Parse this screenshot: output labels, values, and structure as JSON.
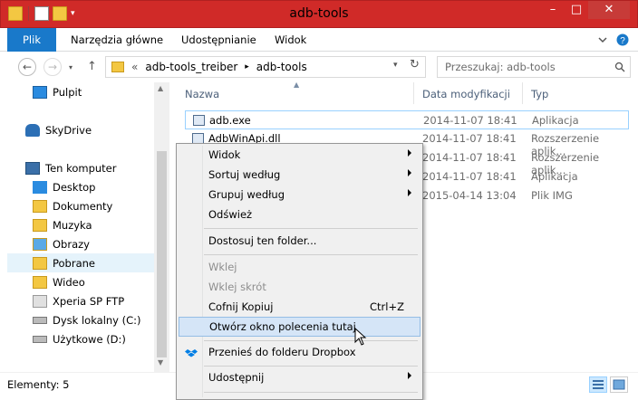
{
  "window": {
    "title": "adb-tools",
    "minimize_glyph": "–",
    "maximize_glyph": "□",
    "close_glyph": "✕"
  },
  "ribbon": {
    "tabs": [
      {
        "label": "Plik"
      },
      {
        "label": "Narzędzia główne"
      },
      {
        "label": "Udostępnianie"
      },
      {
        "label": "Widok"
      }
    ]
  },
  "address": {
    "prefix": "«",
    "crumbs": [
      "adb-tools_treiber",
      "adb-tools"
    ],
    "search_placeholder": "Przeszukaj: adb-tools"
  },
  "sidebar": {
    "items": [
      {
        "label": "Pulpit",
        "icon": "desktop-icon"
      },
      {
        "label": "SkyDrive",
        "icon": "skydrive-icon"
      },
      {
        "label": "Ten komputer",
        "icon": "computer-icon"
      },
      {
        "label": "Desktop",
        "icon": "folder-icon"
      },
      {
        "label": "Dokumenty",
        "icon": "documents-icon"
      },
      {
        "label": "Muzyka",
        "icon": "music-icon"
      },
      {
        "label": "Obrazy",
        "icon": "pictures-icon"
      },
      {
        "label": "Pobrane",
        "icon": "downloads-icon"
      },
      {
        "label": "Wideo",
        "icon": "video-icon"
      },
      {
        "label": "Xperia SP FTP",
        "icon": "ftp-icon"
      },
      {
        "label": "Dysk lokalny (C:)",
        "icon": "drive-icon"
      },
      {
        "label": "Użytkowe (D:)",
        "icon": "drive-icon"
      }
    ]
  },
  "columns": {
    "name": "Nazwa",
    "date": "Data modyfikacji",
    "type": "Typ"
  },
  "files": [
    {
      "name": "adb.exe",
      "date": "2014-11-07 18:41",
      "type": "Aplikacja"
    },
    {
      "name": "AdbWinApi.dll",
      "date": "2014-11-07 18:41",
      "type": "Rozszerzenie aplik..."
    },
    {
      "name": "",
      "date": "2014-11-07 18:41",
      "type": "Rozszerzenie aplik..."
    },
    {
      "name": "",
      "date": "2014-11-07 18:41",
      "type": "Aplikacja"
    },
    {
      "name": "",
      "date": "2015-04-14 13:04",
      "type": "Plik IMG"
    }
  ],
  "status": {
    "items_text": "Elementy: 5"
  },
  "context_menu": {
    "items": [
      {
        "label": "Widok",
        "submenu": true
      },
      {
        "label": "Sortuj według",
        "submenu": true
      },
      {
        "label": "Grupuj według",
        "submenu": true
      },
      {
        "label": "Odśwież"
      },
      {
        "label": "Dostosuj ten folder..."
      },
      {
        "label": "Wklej",
        "disabled": true
      },
      {
        "label": "Wklej skrót",
        "disabled": true
      },
      {
        "label": "Cofnij Kopiuj",
        "shortcut": "Ctrl+Z"
      },
      {
        "label": "Otwórz okno polecenia tutaj",
        "highlighted": true
      },
      {
        "label": "Przenieś do folderu Dropbox"
      },
      {
        "label": "Udostępnij",
        "submenu": true
      }
    ]
  },
  "colors": {
    "titlebar": "#d02a28",
    "plik_tab": "#1979ca",
    "selection": "#d5e5f7"
  }
}
